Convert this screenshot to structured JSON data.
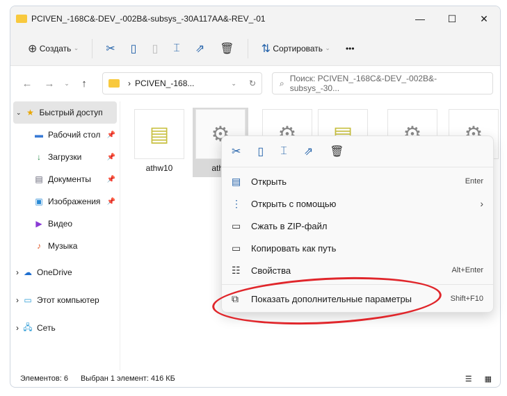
{
  "window": {
    "title": "PCIVEN_-168C&-DEV_-002B&-subsys_-30A117AA&-REV_-01",
    "minimize": "—",
    "maximize": "☐",
    "close": "✕"
  },
  "toolbar": {
    "create": "Создать",
    "sort": "Сортировать",
    "more": "•••"
  },
  "nav": {
    "address": "PCIVEN_-168...",
    "search_placeholder": "Поиск: PCIVEN_-168C&-DEV_-002B&-subsys_-30..."
  },
  "sidebar": {
    "quick": "Быстрый доступ",
    "items": [
      "Рабочий стол",
      "Загрузки",
      "Документы",
      "Изображения",
      "Видео",
      "Музыка"
    ],
    "onedrive": "OneDrive",
    "pc": "Этот компьютер",
    "network": "Сеть"
  },
  "files": [
    "athw10",
    "athw"
  ],
  "status": {
    "count": "Элементов: 6",
    "selected": "Выбран 1 элемент: 416 КБ"
  },
  "menu": {
    "items": [
      {
        "label": "Открыть",
        "key": "Enter"
      },
      {
        "label": "Открыть с помощью",
        "key": "›"
      },
      {
        "label": "Сжать в ZIP-файл",
        "key": ""
      },
      {
        "label": "Копировать как путь",
        "key": ""
      },
      {
        "label": "Свойства",
        "key": "Alt+Enter"
      },
      {
        "label": "Показать дополнительные параметры",
        "key": "Shift+F10"
      }
    ]
  },
  "colors": {
    "accent": "#1f5fa8",
    "highlight": "#e0262b"
  }
}
